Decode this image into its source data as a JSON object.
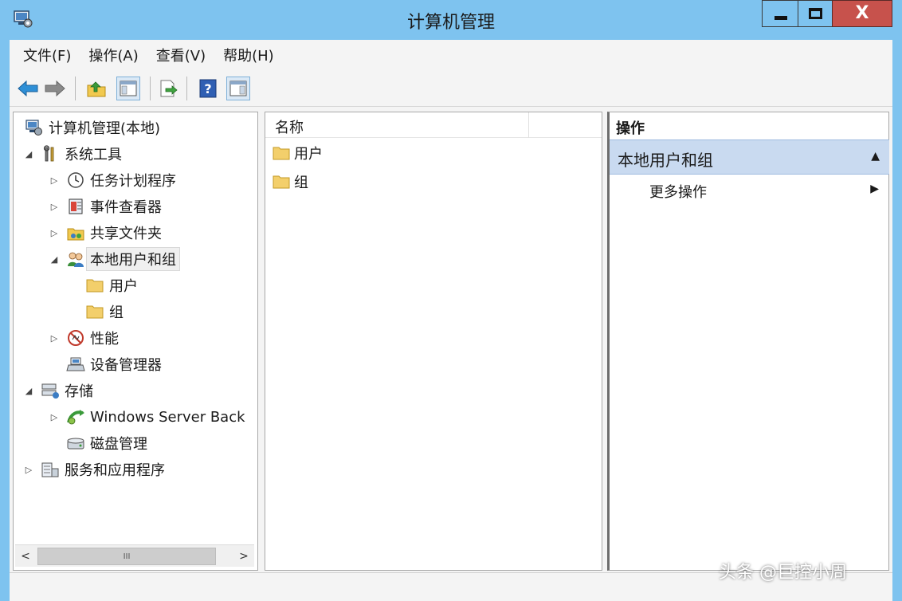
{
  "window": {
    "title": "计算机管理",
    "controls": {
      "minimize": "–",
      "maximize": "□",
      "close": "X"
    }
  },
  "menu": [
    "文件(F)",
    "操作(A)",
    "查看(V)",
    "帮助(H)"
  ],
  "toolbar": {
    "icons": [
      "back-arrow-icon",
      "forward-arrow-icon",
      "up-folder-icon",
      "show-hide-tree-icon",
      "export-list-icon",
      "help-icon",
      "show-hide-action-icon"
    ]
  },
  "tree": {
    "root": "计算机管理(本地)",
    "system_tools": "系统工具",
    "task_scheduler": "任务计划程序",
    "event_viewer": "事件查看器",
    "shared_folders": "共享文件夹",
    "local_users": "本地用户和组",
    "users": "用户",
    "groups": "组",
    "performance": "性能",
    "device_manager": "设备管理器",
    "storage": "存储",
    "wsb": "Windows Server Back",
    "disk_mgmt": "磁盘管理",
    "services_apps": "服务和应用程序"
  },
  "scrollbar": {
    "left": "<",
    "right": ">",
    "grip": "III"
  },
  "list": {
    "column_name": "名称",
    "rows": [
      "用户",
      "组"
    ]
  },
  "actions": {
    "header": "操作",
    "section_title": "本地用户和组",
    "more_actions": "更多操作"
  },
  "watermark": "头条 @巨控小周",
  "colors": {
    "titlebar": "#7ec3ef",
    "close_button": "#c7524c",
    "action_section": "#c9daf0",
    "folder": "#f3cf6b"
  }
}
